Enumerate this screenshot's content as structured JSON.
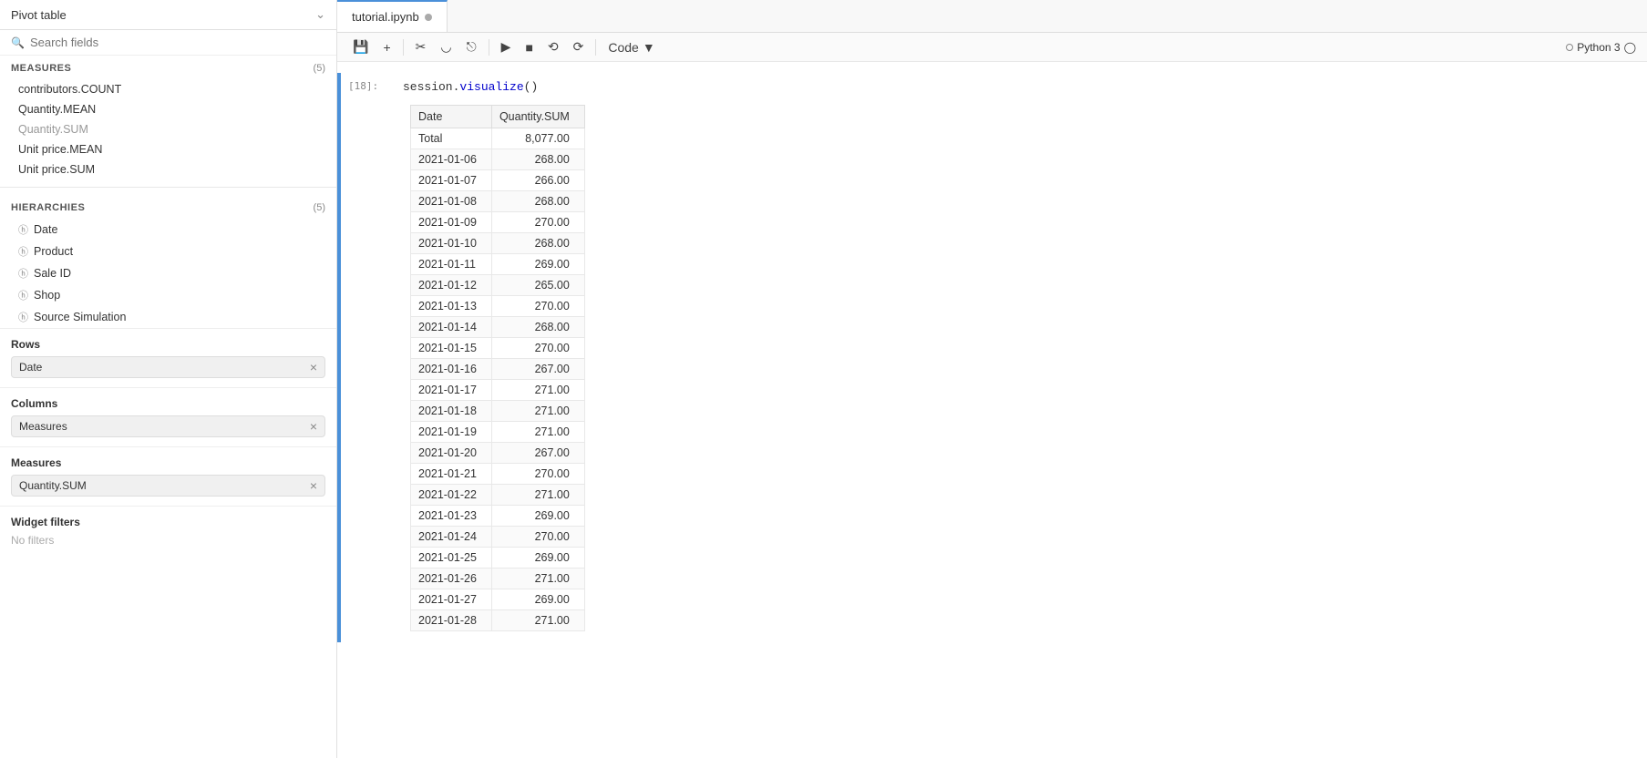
{
  "sidebar": {
    "title": "Pivot table",
    "search_placeholder": "Search fields",
    "measures_label": "MEASURES",
    "measures_count": "(5)",
    "measures_items": [
      {
        "label": "contributors.COUNT",
        "active": false
      },
      {
        "label": "Quantity.MEAN",
        "active": false
      },
      {
        "label": "Quantity.SUM",
        "active": true
      },
      {
        "label": "Unit price.MEAN",
        "active": false
      },
      {
        "label": "Unit price.SUM",
        "active": false
      }
    ],
    "hierarchies_label": "HIERARCHIES",
    "hierarchies_count": "(5)",
    "hierarchies_items": [
      {
        "label": "Date",
        "icon": "⊞"
      },
      {
        "label": "Product",
        "icon": "⊞"
      },
      {
        "label": "Sale ID",
        "icon": "⊞"
      },
      {
        "label": "Shop",
        "icon": "⊞"
      },
      {
        "label": "Source Simulation",
        "icon": "⊞"
      }
    ],
    "rows_label": "Rows",
    "rows_item": "Date",
    "columns_label": "Columns",
    "columns_item": "Measures",
    "measures_section_label": "Measures",
    "measures_section_item": "Quantity.SUM",
    "widget_filters_label": "Widget filters",
    "no_filters": "No filters"
  },
  "notebook": {
    "tab_label": "tutorial.ipynb",
    "cell_number": "[18]:",
    "cell_code_prefix": "session.",
    "cell_code_func": "visualize",
    "cell_code_suffix": "()"
  },
  "toolbar": {
    "kernel_label": "Python 3",
    "code_label": "Code"
  },
  "table": {
    "col_date": "Date",
    "col_quantity": "Quantity.SUM",
    "total_label": "Total",
    "total_value": "8,077.00",
    "rows": [
      {
        "date": "2021-01-06",
        "value": "268.00"
      },
      {
        "date": "2021-01-07",
        "value": "266.00"
      },
      {
        "date": "2021-01-08",
        "value": "268.00"
      },
      {
        "date": "2021-01-09",
        "value": "270.00"
      },
      {
        "date": "2021-01-10",
        "value": "268.00"
      },
      {
        "date": "2021-01-11",
        "value": "269.00"
      },
      {
        "date": "2021-01-12",
        "value": "265.00"
      },
      {
        "date": "2021-01-13",
        "value": "270.00"
      },
      {
        "date": "2021-01-14",
        "value": "268.00"
      },
      {
        "date": "2021-01-15",
        "value": "270.00"
      },
      {
        "date": "2021-01-16",
        "value": "267.00"
      },
      {
        "date": "2021-01-17",
        "value": "271.00"
      },
      {
        "date": "2021-01-18",
        "value": "271.00"
      },
      {
        "date": "2021-01-19",
        "value": "271.00"
      },
      {
        "date": "2021-01-20",
        "value": "267.00"
      },
      {
        "date": "2021-01-21",
        "value": "270.00"
      },
      {
        "date": "2021-01-22",
        "value": "271.00"
      },
      {
        "date": "2021-01-23",
        "value": "269.00"
      },
      {
        "date": "2021-01-24",
        "value": "270.00"
      },
      {
        "date": "2021-01-25",
        "value": "269.00"
      },
      {
        "date": "2021-01-26",
        "value": "271.00"
      },
      {
        "date": "2021-01-27",
        "value": "269.00"
      },
      {
        "date": "2021-01-28",
        "value": "271.00"
      }
    ]
  }
}
